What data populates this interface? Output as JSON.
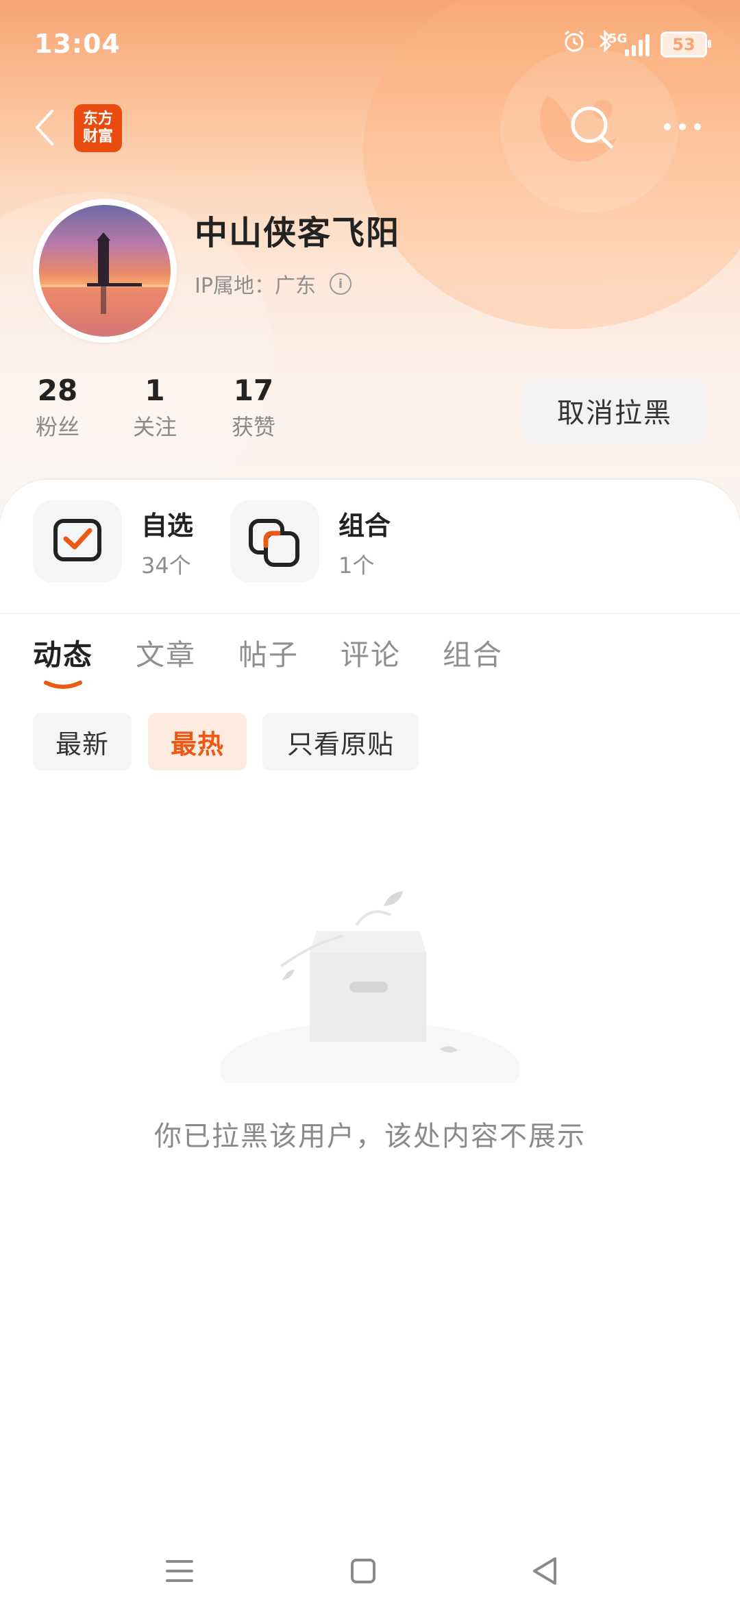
{
  "status_bar": {
    "time": "13:04",
    "network": "5G",
    "battery": "53"
  },
  "top_nav": {
    "logo_line1": "东方",
    "logo_line2": "财富"
  },
  "profile": {
    "name": "中山侠客飞阳",
    "ip_location": "IP属地：广东",
    "stats": [
      {
        "value": "28",
        "label": "粉丝"
      },
      {
        "value": "1",
        "label": "关注"
      },
      {
        "value": "17",
        "label": "获赞"
      }
    ],
    "action_button": "取消拉黑"
  },
  "entries": [
    {
      "title": "自选",
      "subtitle": "34个"
    },
    {
      "title": "组合",
      "subtitle": "1个"
    }
  ],
  "tabs": [
    "动态",
    "文章",
    "帖子",
    "评论",
    "组合"
  ],
  "active_tab": "动态",
  "filters": [
    "最新",
    "最热",
    "只看原贴"
  ],
  "active_filter": "最热",
  "empty_state": {
    "message": "你已拉黑该用户，该处内容不展示"
  },
  "colors": {
    "accent": "#ea5a14",
    "brand": "#ea4c10"
  }
}
